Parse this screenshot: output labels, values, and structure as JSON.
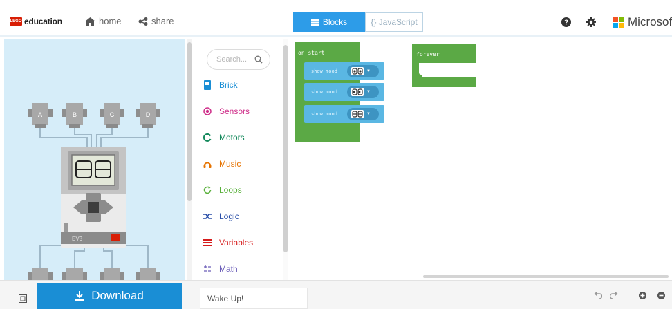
{
  "header": {
    "logo_badge": "LEGO",
    "logo_text": "education",
    "home_label": "home",
    "share_label": "share",
    "tabs": [
      {
        "label": "Blocks",
        "active": true
      },
      {
        "label": "{} JavaScript",
        "active": false
      }
    ],
    "brand_text": "Microsof",
    "brand_colors": [
      "#f35325",
      "#81bc06",
      "#05a6f0",
      "#ffba08"
    ]
  },
  "simulator": {
    "ports_top": [
      "A",
      "B",
      "C",
      "D"
    ],
    "brick_label": "EV3",
    "brick_badge": "LEGO"
  },
  "toolbox": {
    "search_placeholder": "Search...",
    "categories": [
      {
        "label": "Brick",
        "icon": "brick-icon",
        "color": "#1a8ed5"
      },
      {
        "label": "Sensors",
        "icon": "sensors-icon",
        "color": "#cf2f8a"
      },
      {
        "label": "Motors",
        "icon": "motors-icon",
        "color": "#13885b"
      },
      {
        "label": "Music",
        "icon": "music-icon",
        "color": "#e67300"
      },
      {
        "label": "Loops",
        "icon": "loops-icon",
        "color": "#58b03a"
      },
      {
        "label": "Logic",
        "icon": "logic-icon",
        "color": "#2a4fa8"
      },
      {
        "label": "Variables",
        "icon": "variables-icon",
        "color": "#d61c1c"
      },
      {
        "label": "Math",
        "icon": "math-icon",
        "color": "#6a5cb8"
      }
    ]
  },
  "workspace": {
    "on_start": "on start",
    "forever": "forever",
    "show_mood_label": "show mood",
    "show_mood_count": 3
  },
  "bottom": {
    "download_label": "Download",
    "project_name": "Wake Up!"
  },
  "colors": {
    "accent": "#2d9ce8",
    "download": "#1a8ed5",
    "event_block": "#5ba945",
    "brick_block": "#5ab7e3",
    "sim_bg": "#d6edf9"
  }
}
